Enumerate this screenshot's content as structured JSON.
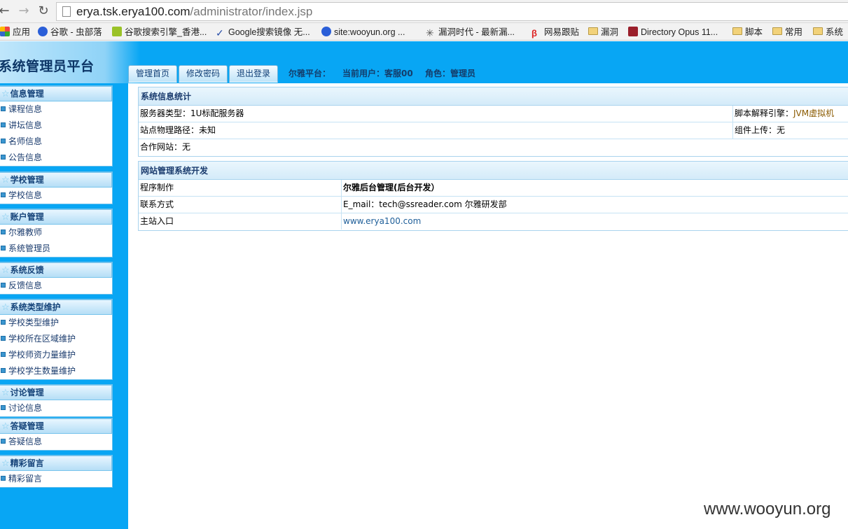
{
  "browser": {
    "back_icon": "back-arrow-icon",
    "forward_icon": "forward-arrow-icon",
    "reload_icon": "reload-icon",
    "url_host": "erya.tsk.erya100.com",
    "url_path": "/administrator/index.jsp",
    "bookmarks": [
      {
        "label": "应用",
        "icon": "apps-icon"
      },
      {
        "label": "谷歌 - 虫部落",
        "icon": "paw-icon"
      },
      {
        "label": "谷歌搜索引擎_香港...",
        "icon": "green-icon"
      },
      {
        "label": "Google搜索镜像 无...",
        "icon": "bird-icon"
      },
      {
        "label": "site:wooyun.org ...",
        "icon": "paw-icon"
      },
      {
        "label": "漏洞时代 - 最新漏...",
        "icon": "star-icon"
      },
      {
        "label": "网易跟贴",
        "icon": "netease-icon"
      },
      {
        "label": "漏洞",
        "icon": "folder-icon"
      },
      {
        "label": "Directory Opus 11...",
        "icon": "dopus-icon"
      },
      {
        "label": "脚本",
        "icon": "folder-icon"
      },
      {
        "label": "常用",
        "icon": "folder-icon"
      },
      {
        "label": "系统",
        "icon": "folder-icon"
      }
    ]
  },
  "app": {
    "title": "系统管理员平台",
    "tabs": [
      "管理首页",
      "修改密码",
      "退出登录"
    ],
    "platform_label": "尔雅平台：",
    "current_user": "当前用户：客服00",
    "role": "角色：管理员"
  },
  "sidebar": {
    "groups": [
      {
        "title": "信息管理",
        "items": [
          "课程信息",
          "讲坛信息",
          "名师信息",
          "公告信息"
        ]
      },
      {
        "title": "学校管理",
        "items": [
          "学校信息"
        ]
      },
      {
        "title": "账户管理",
        "items": [
          "尔雅教师",
          "系统管理员"
        ]
      },
      {
        "title": "系统反馈",
        "items": [
          "反馈信息"
        ]
      },
      {
        "title": "系统类型维护",
        "items": [
          "学校类型维护",
          "学校所在区域维护",
          "学校师资力量维护",
          "学校学生数量维护"
        ]
      },
      {
        "title": "讨论管理",
        "items": [
          "讨论信息"
        ]
      },
      {
        "title": "答疑管理",
        "items": [
          "答疑信息"
        ]
      },
      {
        "title": "精彩留言",
        "items": [
          "精彩留言"
        ]
      }
    ]
  },
  "sysinfo": {
    "title": "系统信息统计",
    "server_type": "服务器类型：1U标配服务器",
    "script_engine_label": "脚本解释引擎：",
    "script_engine_value": "JVM虚拟机",
    "physical_path": "站点物理路径：未知",
    "component_upload": "组件上传：无",
    "partner_sites": "合作网站：无"
  },
  "devinfo": {
    "title": "网站管理系统开发",
    "rows": [
      {
        "label": "程序制作",
        "value": "尔雅后台管理(后台开发）"
      },
      {
        "label": "联系方式",
        "value": "E_mail：tech@ssreader.com 尔雅研发部"
      },
      {
        "label": "主站入口",
        "value": "www.erya100.com"
      }
    ]
  },
  "watermark": "www.wooyun.org"
}
